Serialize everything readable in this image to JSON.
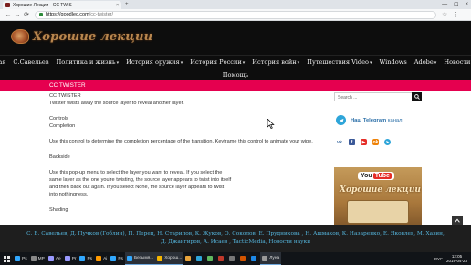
{
  "browser": {
    "tab_title": "Хорошие Лекции - CC TWIS",
    "tab_close": "×",
    "new_tab": "+",
    "window_controls": [
      "—",
      "☐",
      "×"
    ],
    "url_host": "https://goodlec.com",
    "url_path": "/cc-twister/",
    "nav_back": "←",
    "nav_forward": "→",
    "nav_reload": "⟳",
    "bookmark_star": "☆",
    "menu": "⋮"
  },
  "site": {
    "logo_text": "Хорошие лекции",
    "nav_row1": [
      {
        "label": "Главная",
        "caret": ""
      },
      {
        "label": "С.Савельев",
        "caret": ""
      },
      {
        "label": "Политика и жизнь",
        "caret": "▾"
      },
      {
        "label": "История оружия",
        "caret": "▾"
      },
      {
        "label": "История России",
        "caret": "▾"
      },
      {
        "label": "История войн",
        "caret": "▾"
      },
      {
        "label": "Путешествия Video",
        "caret": "▾"
      },
      {
        "label": "Windows",
        "caret": ""
      },
      {
        "label": "Adobe",
        "caret": "▾"
      },
      {
        "label": "Новости науки",
        "caret": ""
      }
    ],
    "nav_row2": [
      {
        "label": "Помощь",
        "caret": ""
      }
    ],
    "section_label": "CC TWISTER"
  },
  "article": {
    "title": "CC TWISTER",
    "intro": "Twister twists away the source layer to reveal another layer.",
    "controls_heading": "Controls",
    "completion_heading": "Completion",
    "completion_text": "Use this control to determine the completion percentage of the transition. Keyframe this control to animate your wipe.",
    "backside_heading": "Backside",
    "backside_text_1": "Use this pop-up menu to select the layer you want to reveal. If you select the",
    "backside_text_2": "same layer as the one you're twisting, the source layer appears to twist into itself",
    "backside_text_3": "and then back out again. If you select None, the source layer appears to twist",
    "backside_text_4": "into nothingness.",
    "shading_heading": "Shading"
  },
  "sidebar": {
    "search_placeholder": "Search ...",
    "telegram_bold": "Наш Telegram",
    "telegram_rest": " канал",
    "social": [
      {
        "name": "vk",
        "glyph": "vk"
      },
      {
        "name": "facebook",
        "glyph": "f"
      },
      {
        "name": "youtube",
        "glyph": "▶"
      },
      {
        "name": "odnoklassniki",
        "glyph": "ok"
      },
      {
        "name": "telegram",
        "glyph": "➤"
      }
    ],
    "yt_you": "You",
    "yt_tube": "Tube",
    "banner_text": "Хорошие лекции"
  },
  "footer": {
    "line1": "С. В. Савельев,  Д. Пучков (Гоблин),  П. Перец,  Н. Старилов,  К. Жуков,  О. Соколов,  Е. Прудникова ,  Н. Ашмаков,  К. Назаренко,  Е. Яковлев, М. Хазин,",
    "line2": "Д. Джангиров,  А. Исаев ,  TacticMedia,  Новости науки"
  },
  "taskbar": {
    "items": [
      {
        "label": "Ps",
        "color": "#31a8ff"
      },
      {
        "label": "MP",
        "color": "#888888"
      },
      {
        "label": "Ae",
        "color": "#9999ff"
      },
      {
        "label": "Pr",
        "color": "#9999ff"
      },
      {
        "label": "Ps",
        "color": "#31a8ff"
      },
      {
        "label": "Ai",
        "color": "#ff9a00"
      },
      {
        "label": "Ps",
        "color": "#31a8ff"
      },
      {
        "label": "Безымя...",
        "color": "#31a8ff"
      },
      {
        "label": "Хорош...",
        "color": "#f4b400"
      },
      {
        "label": "",
        "color": "#e8a33b"
      },
      {
        "label": "",
        "color": "#2ea5d9"
      },
      {
        "label": "",
        "color": "#5fb85f"
      },
      {
        "label": "",
        "color": "#c0392b"
      },
      {
        "label": "",
        "color": "#777777"
      },
      {
        "label": "",
        "color": "#d35400"
      },
      {
        "label": "",
        "color": "#1e88e5"
      },
      {
        "label": "Луна",
        "color": "#999999"
      }
    ],
    "tray_lang": "РУС",
    "time": "12:05",
    "date": "2019-04-23"
  },
  "colors": {
    "accent_pink": "#e5004f",
    "header_black": "#0d0d0d",
    "footer_link": "#55b7df"
  }
}
